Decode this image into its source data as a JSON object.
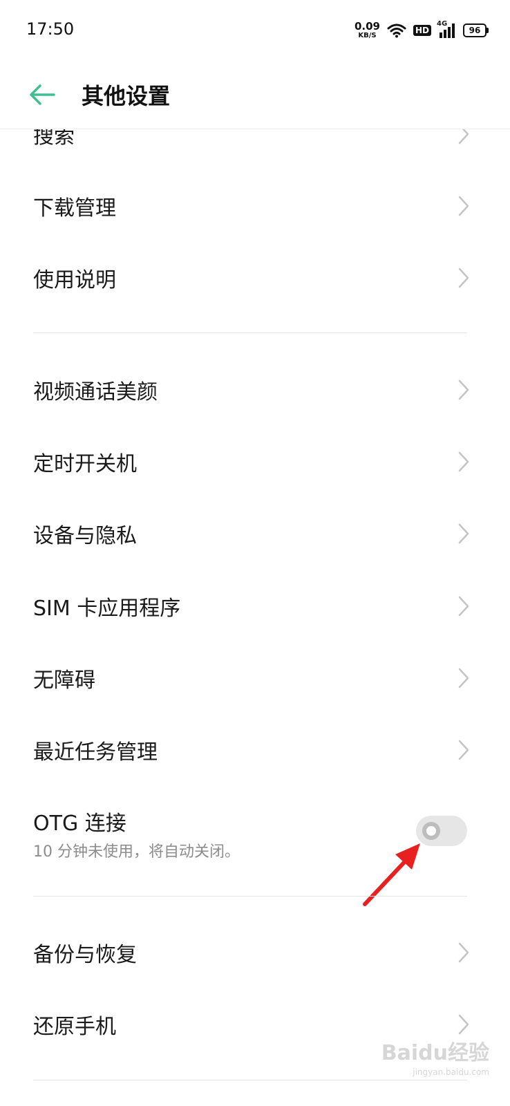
{
  "status_bar": {
    "time": "17:50",
    "net_speed_value": "0.09",
    "net_speed_unit": "KB/S",
    "hd": "HD",
    "network": "4G",
    "battery": "96"
  },
  "header": {
    "title": "其他设置",
    "accent_color": "#3fbf8f"
  },
  "items": [
    {
      "label": "搜索"
    },
    {
      "label": "下载管理"
    },
    {
      "label": "使用说明"
    },
    {
      "label": "视频通话美颜"
    },
    {
      "label": "定时开关机"
    },
    {
      "label": "设备与隐私"
    },
    {
      "label": "SIM 卡应用程序"
    },
    {
      "label": "无障碍"
    },
    {
      "label": "最近任务管理"
    },
    {
      "label": "备份与恢复"
    },
    {
      "label": "还原手机"
    }
  ],
  "otg": {
    "title": "OTG 连接",
    "subtitle": "10 分钟未使用，将自动关闭。",
    "enabled": false
  },
  "annotation": {
    "arrow_color": "#e82020"
  },
  "watermark": {
    "text": "Baidu经验",
    "url": "jingyan.baidu.com"
  }
}
